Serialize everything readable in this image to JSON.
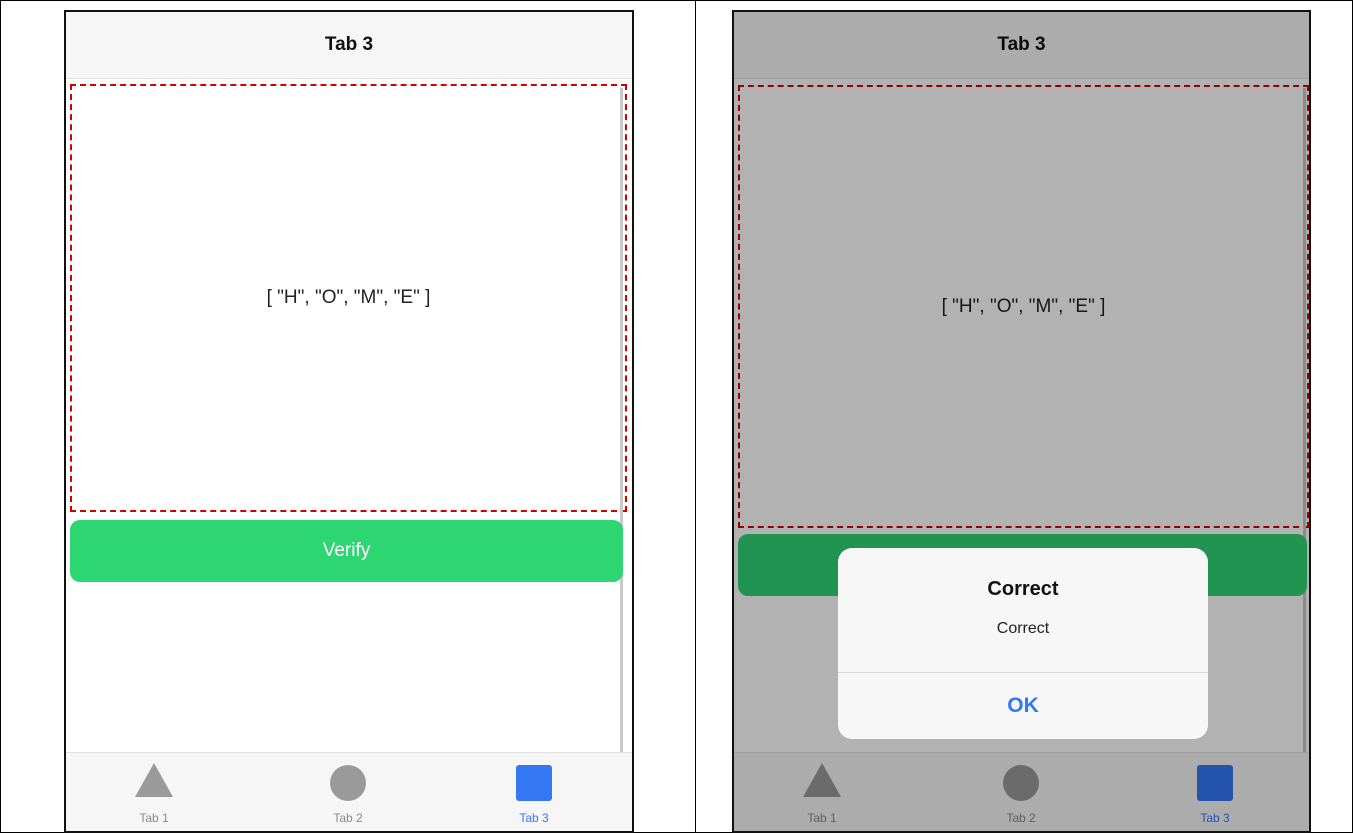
{
  "left_screen": {
    "title": "Tab 3",
    "content_text": "[ \"H\", \"O\", \"M\", \"E\" ]",
    "verify_label": "Verify",
    "tabs": [
      {
        "label": "Tab 1",
        "icon": "triangle-icon",
        "active": false
      },
      {
        "label": "Tab 2",
        "icon": "circle-icon",
        "active": false
      },
      {
        "label": "Tab 3",
        "icon": "square-icon",
        "active": true
      }
    ]
  },
  "right_screen": {
    "title": "Tab 3",
    "content_text": "[ \"H\", \"O\", \"M\", \"E\" ]",
    "alert": {
      "title": "Correct",
      "message": "Correct",
      "ok_label": "OK"
    },
    "tabs": [
      {
        "label": "Tab 1",
        "icon": "triangle-icon",
        "active": false
      },
      {
        "label": "Tab 2",
        "icon": "circle-icon",
        "active": false
      },
      {
        "label": "Tab 3",
        "icon": "square-icon",
        "active": true
      }
    ]
  },
  "colors": {
    "accent": "#3478f6",
    "verify_button": "#2ed573",
    "highlight_border": "#d40000"
  }
}
